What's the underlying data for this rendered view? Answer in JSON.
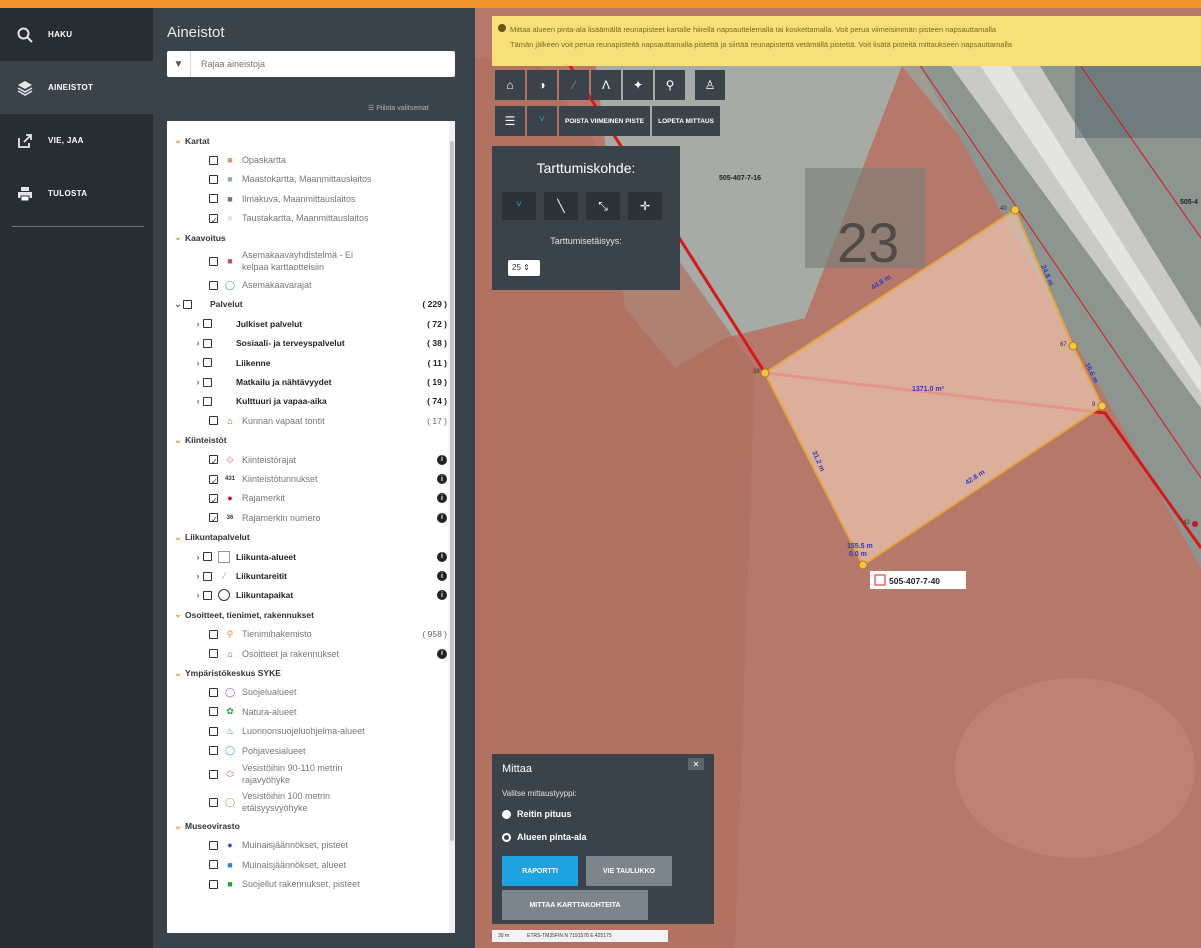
{
  "nav": {
    "items": [
      {
        "label": "HAKU",
        "icon": "search-icon"
      },
      {
        "label": "AINEISTOT",
        "icon": "layers-icon",
        "active": true
      },
      {
        "label": "VIE, JAA",
        "icon": "share-icon"
      },
      {
        "label": "TULOSTA",
        "icon": "print-icon"
      }
    ]
  },
  "panel": {
    "title": "Aineistot",
    "filter_placeholder": "Rajaa aineistoja",
    "hide_selected": "Piilota valitsemat",
    "tree": [
      {
        "type": "group",
        "label": "Kartat"
      },
      {
        "type": "layer",
        "label": "Opaskartta",
        "checked": false,
        "icon": "map-icon",
        "color": "#c8a070"
      },
      {
        "type": "layer",
        "label": "Maastokartta, Maanmittauslaitos",
        "checked": false,
        "icon": "map-icon",
        "color": "#9aa8b0"
      },
      {
        "type": "layer",
        "label": "Ilmakuva, Maanmittauslaitos",
        "checked": false,
        "icon": "photo-icon",
        "color": "#6f7a6a"
      },
      {
        "type": "layer",
        "label": "Taustakartta, Maanmittauslaitos",
        "checked": true,
        "icon": "map-icon",
        "color": "#dfe5ea"
      },
      {
        "type": "group",
        "label": "Kaavoitus"
      },
      {
        "type": "layer",
        "label": "Asemakaavayhdistelmä - Ei",
        "label2": "kelpaa karttaotteisiin",
        "checked": false,
        "icon": "plan-icon",
        "color": "#c05070",
        "tall": true
      },
      {
        "type": "layer",
        "label": "Asemakaavarajat",
        "checked": false,
        "icon": "circle-icon",
        "color": "#3a8fd8"
      },
      {
        "type": "folder",
        "label": "Palvelut",
        "count": "( 229 )"
      },
      {
        "type": "sub",
        "label": "Julkiset palvelut",
        "count": "( 72 )"
      },
      {
        "type": "sub",
        "label": "Sosiaali- ja terveyspalvelut",
        "count": "( 38 )"
      },
      {
        "type": "sub",
        "label": "Liikenne",
        "count": "( 11 )"
      },
      {
        "type": "sub",
        "label": "Matkailu ja nähtävyydet",
        "count": "( 19 )"
      },
      {
        "type": "sub",
        "label": "Kulttuuri ja vapaa-aika",
        "count": "( 74 )"
      },
      {
        "type": "layer",
        "label": "Kunnan vapaat tontit",
        "checked": false,
        "icon": "home-icon",
        "color": "#2a8a3a",
        "count": "( 17 )"
      },
      {
        "type": "group",
        "label": "Kiinteistöt"
      },
      {
        "type": "layer",
        "label": "Kiinteistörajat",
        "checked": true,
        "icon": "border-icon",
        "color": "#e05070",
        "info": true
      },
      {
        "type": "layer",
        "label": "Kiinteistötunnukset",
        "checked": true,
        "icon": "text-icon",
        "color": "#333333",
        "glyph": "431",
        "info": true
      },
      {
        "type": "layer",
        "label": "Rajamerkit",
        "checked": true,
        "icon": "dot-icon",
        "color": "#c0182a",
        "info": true
      },
      {
        "type": "layer",
        "label": "Rajamerkin numero",
        "checked": true,
        "icon": "text-icon",
        "color": "#333333",
        "glyph": "36",
        "info": true
      },
      {
        "type": "group",
        "label": "Liikuntapalvelut"
      },
      {
        "type": "subcb",
        "label": "Liikunta-alueet",
        "icon": "square-icon",
        "info": true
      },
      {
        "type": "subcb",
        "label": "Liikuntareitit",
        "icon": "line-icon",
        "info": true
      },
      {
        "type": "subcb",
        "label": "Liikuntapaikat",
        "icon": "ring-icon",
        "info": true
      },
      {
        "type": "group",
        "label": "Osoitteet, tienimet, rakennukset"
      },
      {
        "type": "layer",
        "label": "Tienimihakemisto",
        "checked": false,
        "icon": "pin-icon",
        "color": "#e8902a",
        "count": "( 958 )"
      },
      {
        "type": "layer",
        "label": "Osoitteet ja rakennukset",
        "checked": false,
        "icon": "house-icon",
        "color": "#c0188a",
        "info": true
      },
      {
        "type": "group",
        "label": "Ympäristökeskus SYKE"
      },
      {
        "type": "layer",
        "label": "Suojelualueet",
        "checked": false,
        "icon": "circle-icon",
        "color": "#b040d0"
      },
      {
        "type": "layer",
        "label": "Natura-alueet",
        "checked": false,
        "icon": "flower-icon",
        "color": "#2aa040"
      },
      {
        "type": "layer",
        "label": "Luonnonsuojeluohjelma-alueet",
        "checked": false,
        "icon": "water-icon",
        "color": "#2a70d0"
      },
      {
        "type": "layer",
        "label": "Pohjavesialueet",
        "checked": false,
        "icon": "circle-icon",
        "color": "#30a0d8"
      },
      {
        "type": "layer",
        "label": "Vesistöihin 90-110 metrin",
        "label2": "rajavyöhyke",
        "checked": false,
        "icon": "oval-icon",
        "color": "#c040c0",
        "tall": true
      },
      {
        "type": "layer",
        "label": "Vesistöihin 100 metrin",
        "label2": "etäisyysvyöhyke",
        "checked": false,
        "icon": "circle-icon",
        "color": "#e08a30",
        "tall": true
      },
      {
        "type": "group",
        "label": "Museovirasto"
      },
      {
        "type": "layer",
        "label": "Muinaisjäännökset, pisteet",
        "checked": false,
        "icon": "dot-icon",
        "color": "#2a5ab8"
      },
      {
        "type": "layer",
        "label": "Muinaisjäännökset, alueet",
        "checked": false,
        "icon": "area-icon",
        "color": "#3a80d0"
      },
      {
        "type": "layer",
        "label": "Suojellut rakennukset, pisteet",
        "checked": false,
        "icon": "square-icon",
        "color": "#2aa040"
      }
    ]
  },
  "map": {
    "notice_line1": "Mittaa alueen pinta-ala lisäämällä reunapisteet kartalle hiirellä napsauttelemalla tai koskettamalla. Voit perua viimeisimmän pisteen napsauttamalla",
    "notice_line2": "Tämän jälkeen voit perua reunapisteitä napsauttamalla pistettä ja siirtää reunapistettä vetämällä pistettä. Voit lisätä pisteitä mittaukseen napsauttamalla",
    "toolbar_icons": [
      "home-icon",
      "contrast-icon",
      "draw-icon",
      "angle-icon",
      "move-icon",
      "location-icon",
      "person-icon"
    ],
    "toolbar2_icons": [
      "list-icon",
      "measure-icon"
    ],
    "remove_last_point": "POISTA VIIMEINEN PISTE",
    "stop_measure": "LOPETA MITTAUS",
    "parcel_number": "23",
    "parcel_id_top": "505-407-7-16",
    "parcel_id_right": "505-4",
    "area_label": "1371.0 m²",
    "edge_top": "44.8 m",
    "edge_right_top": "24.8 m",
    "edge_right_bottom": "16.6 m",
    "edge_bottom": "42.8 m",
    "edge_left": "31.2 m",
    "point_label_1": "155.5 m",
    "point_label_2": "0.0 m",
    "point_a": "40",
    "point_b": "38",
    "point_c": "67",
    "point_d": "9",
    "point_e": "42",
    "parcel_id_bottom": "505-407-7-40",
    "accent": "#f0932b",
    "measure_line": "#e8a640"
  },
  "snap": {
    "title": "Tarttumiskohde:",
    "tolerance_label": "Tarttumisetäisyys:",
    "tolerance_value": "25",
    "icons": [
      "vertex-icon",
      "line-icon",
      "segment-icon",
      "crosshair-icon"
    ]
  },
  "measure": {
    "title": "Mittaa",
    "type_label": "Valitse mittaustyyppi:",
    "opt_route": "Reitin pituus",
    "opt_area": "Alueen pinta-ala",
    "report_btn": "RAPORTTI",
    "export_btn": "VIE TAULUKKO",
    "coords_btn": "MITTAA KARTTAKOHTEITA",
    "report_color": "#1ea3e0"
  },
  "scale": {
    "label": "30 m",
    "coords": "ETRS-TM35FIN N 7191578 E 425175"
  }
}
